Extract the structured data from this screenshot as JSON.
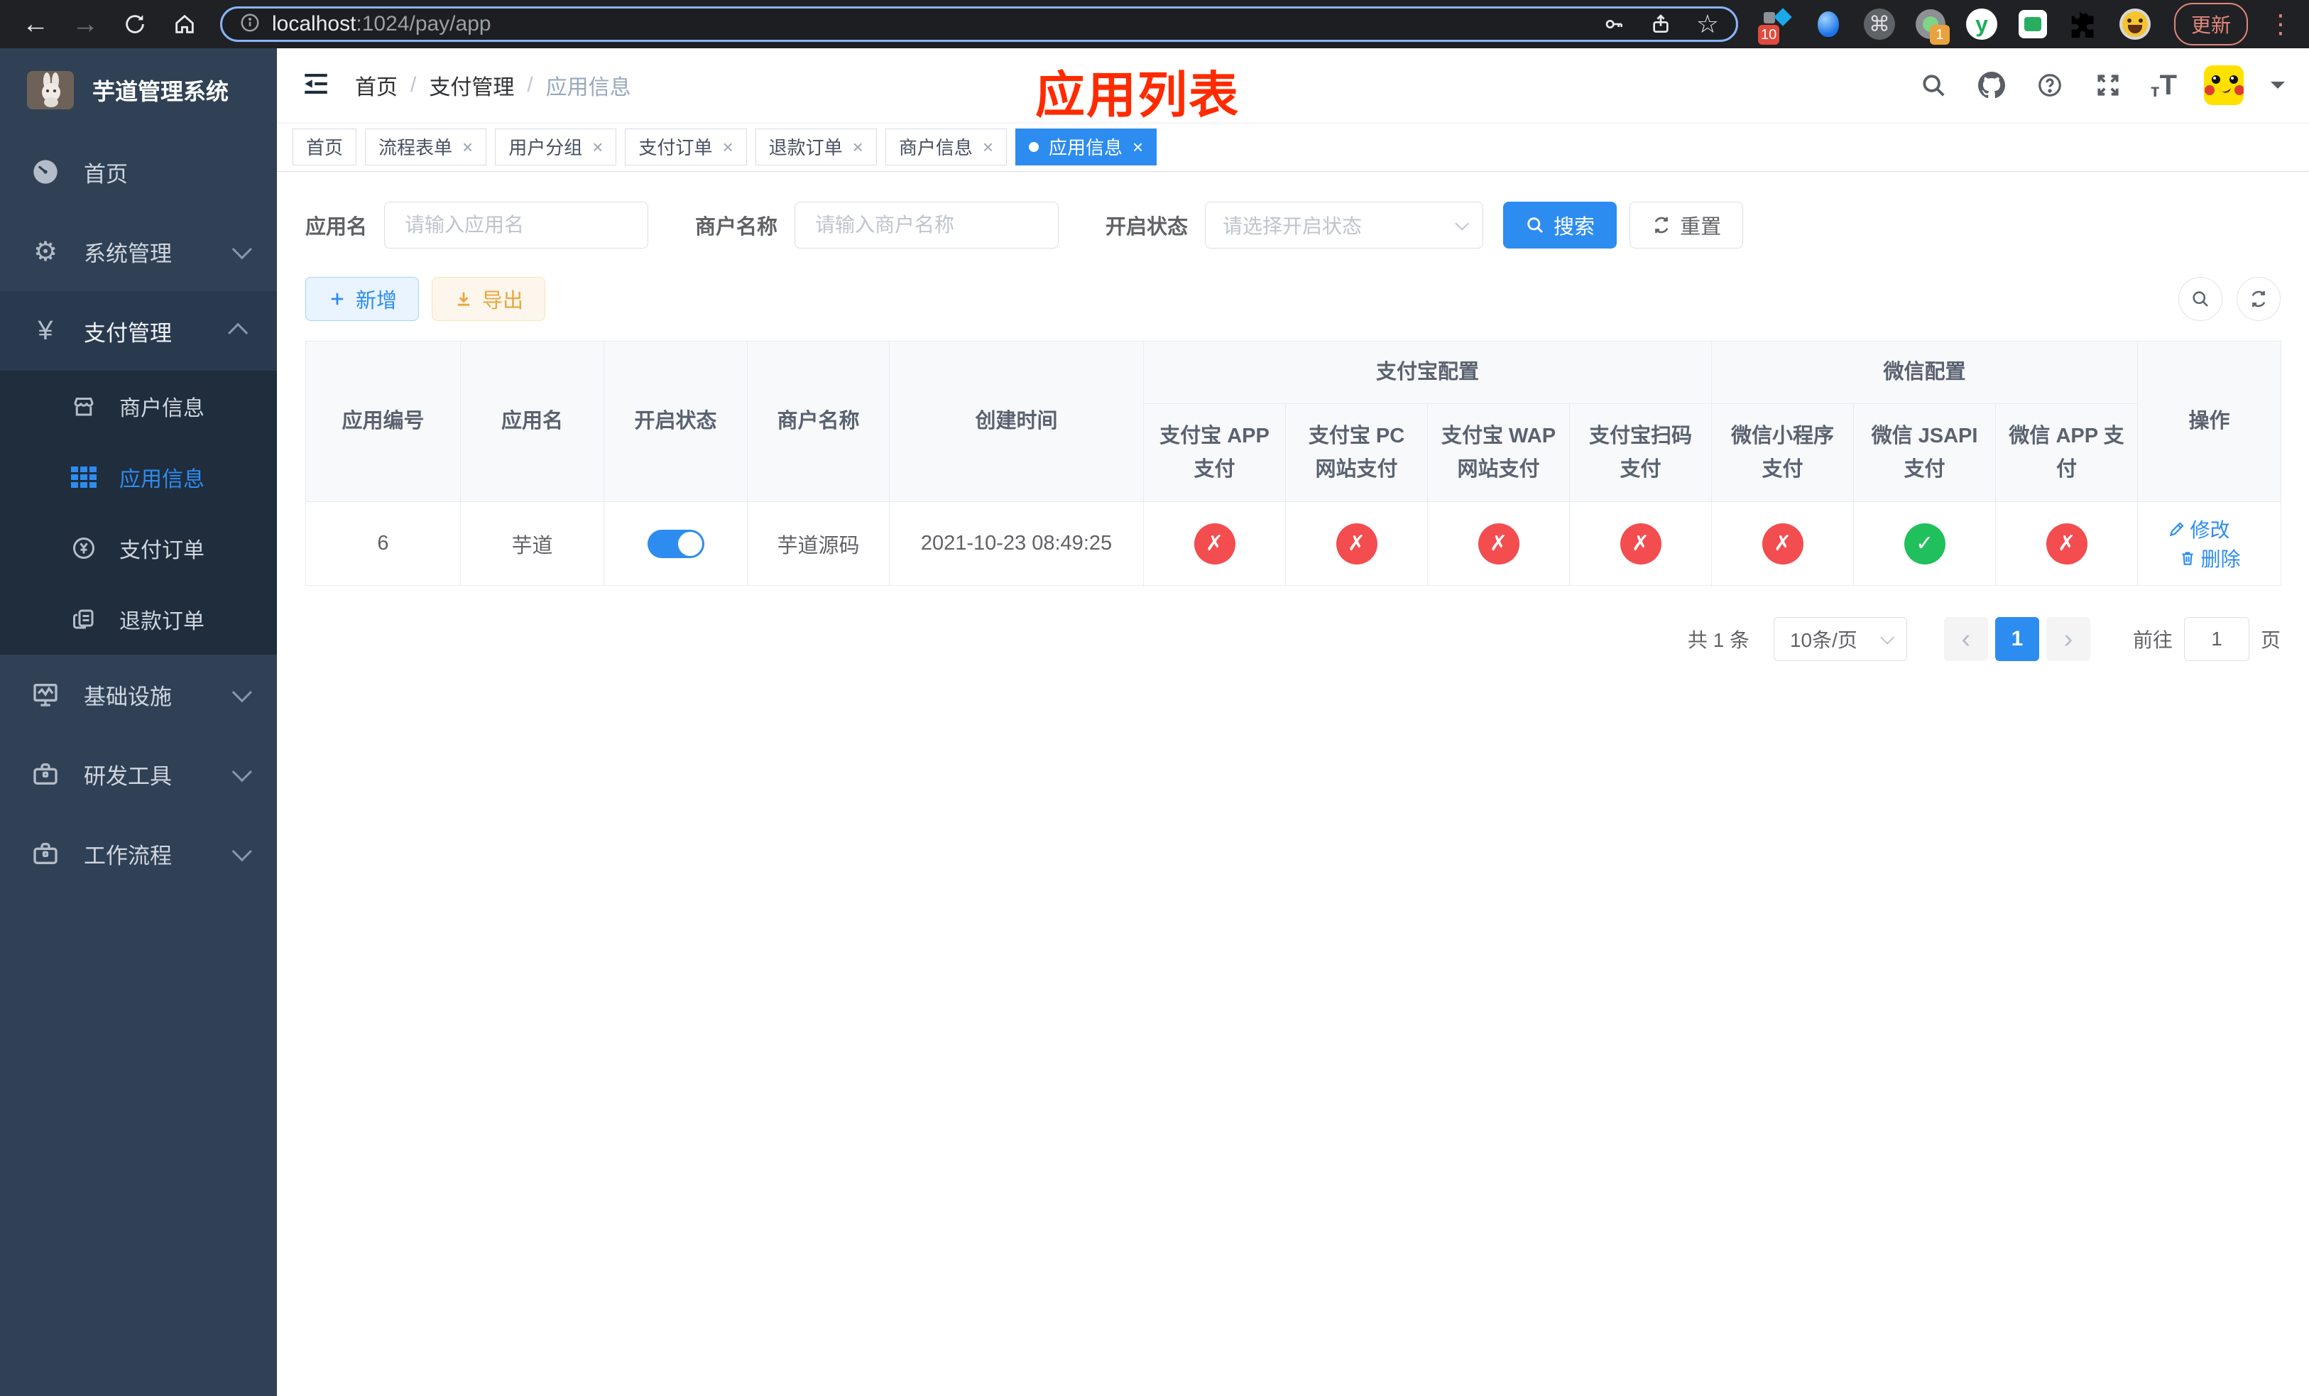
{
  "colors": {
    "accent": "#2d8cf0",
    "success": "#20c05c",
    "danger": "#f34d4f",
    "warning": "#eba53b",
    "sidebar_bg": "#304156",
    "submenu_bg": "#1f2d3d",
    "annotation_red": "#ff2b00",
    "chrome_bg": "#202124"
  },
  "browser": {
    "url_host": "localhost",
    "url_path": ":1024/pay/app",
    "ext_badge_10": "10",
    "ext_badge_1": "1",
    "ext_y_label": "y",
    "update_label": "更新"
  },
  "sidebar": {
    "title": "芋道管理系统",
    "menu": [
      {
        "label": "首页"
      },
      {
        "label": "系统管理"
      },
      {
        "label": "支付管理"
      },
      {
        "label": "商户信息"
      },
      {
        "label": "应用信息"
      },
      {
        "label": "支付订单"
      },
      {
        "label": "退款订单"
      },
      {
        "label": "基础设施"
      },
      {
        "label": "研发工具"
      },
      {
        "label": "工作流程"
      }
    ]
  },
  "navbar": {
    "breadcrumb": [
      "首页",
      "支付管理",
      "应用信息"
    ],
    "separator": "/"
  },
  "annotation": "应用列表",
  "tags": [
    {
      "label": "首页"
    },
    {
      "label": "流程表单"
    },
    {
      "label": "用户分组"
    },
    {
      "label": "支付订单"
    },
    {
      "label": "退款订单"
    },
    {
      "label": "商户信息"
    },
    {
      "label": "应用信息"
    }
  ],
  "filter": {
    "app_name_label": "应用名",
    "app_name_placeholder": "请输入应用名",
    "merchant_label": "商户名称",
    "merchant_placeholder": "请输入商户名称",
    "status_label": "开启状态",
    "status_placeholder": "请选择开启状态",
    "search_label": "搜索",
    "reset_label": "重置"
  },
  "toolbar": {
    "add_label": "新增",
    "export_label": "导出"
  },
  "table": {
    "headers": {
      "app_id": "应用编号",
      "app_name": "应用名",
      "status": "开启状态",
      "merchant": "商户名称",
      "created": "创建时间",
      "alipay_group": "支付宝配置",
      "wechat_group": "微信配置",
      "alipay_app": "支付宝 APP 支付",
      "alipay_pc": "支付宝 PC 网站支付",
      "alipay_wap": "支付宝 WAP 网站支付",
      "alipay_qr": "支付宝扫码支付",
      "wx_mini": "微信小程序支付",
      "wx_jsapi": "微信 JSAPI 支付",
      "wx_app": "微信 APP 支付",
      "ops": "操作"
    },
    "row": {
      "app_id": "6",
      "app_name": "芋道",
      "enabled": true,
      "merchant": "芋道源码",
      "created": "2021-10-23 08:49:25",
      "statuses": [
        false,
        false,
        false,
        false,
        false,
        true,
        false
      ],
      "edit_label": "修改",
      "delete_label": "删除"
    }
  },
  "pagination": {
    "total": "共 1 条",
    "page_size": "10条/页",
    "page": "1",
    "goto_label": "前往",
    "goto_value": "1",
    "page_unit": "页"
  },
  "icons": {
    "check": "✓",
    "cross": "✗",
    "close": "×",
    "yen": "¥",
    "cmd": "⌘",
    "star": "☆",
    "back": "←",
    "forward": "→",
    "dots": "⋮",
    "prev": "‹",
    "next": "›",
    "gear": "⚙"
  }
}
